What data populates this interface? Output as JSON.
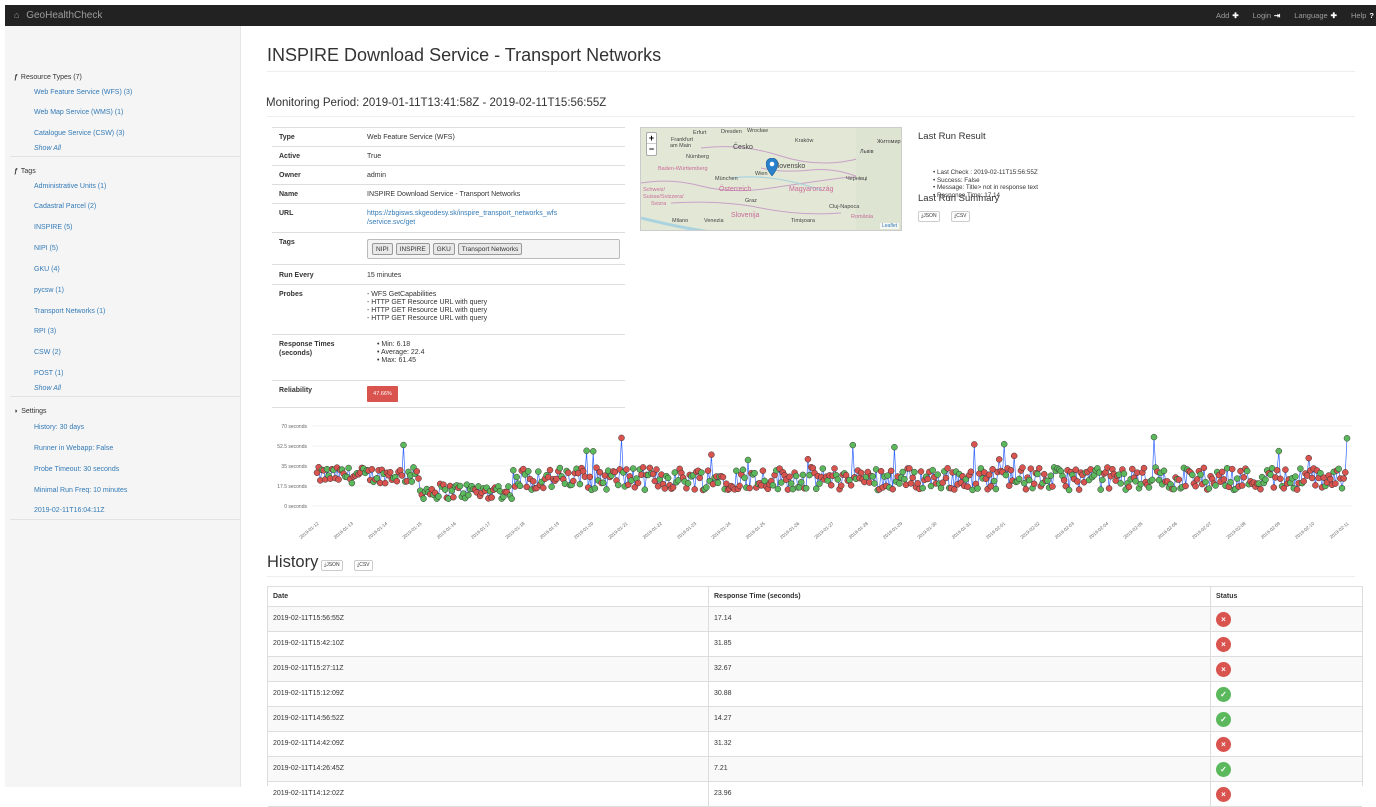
{
  "navbar": {
    "brand": "GeoHealthCheck",
    "items": [
      {
        "label": "Add",
        "icon": "✚"
      },
      {
        "label": "Login",
        "icon": "⇥"
      },
      {
        "label": "Language",
        "icon": "✚"
      },
      {
        "label": "Help",
        "icon": "?"
      }
    ]
  },
  "sidebar": {
    "resource_types_heading": "Resource Types (7)",
    "resource_types": [
      "Web Feature Service (WFS) (3)",
      "Web Map Service (WMS) (1)",
      "Catalogue Service (CSW) (3)"
    ],
    "resource_types_more": "Show All",
    "tags_heading": "Tags",
    "tags": [
      "Administrative Units (1)",
      "Cadastral Parcel (2)",
      "INSPIRE (5)",
      "NIPI (5)",
      "GKU (4)",
      "pycsw (1)",
      "Transport Networks (1)",
      "RPI (3)",
      "CSW (2)",
      "POST (1)"
    ],
    "tags_more": "Show All",
    "settings_heading": "Settings",
    "settings": [
      "History: 30 days",
      "Runner in Webapp: False",
      "Probe Timeout: 30 seconds",
      "Minimal Run Freq: 10 minutes",
      "2019-02-11T16:04:11Z"
    ]
  },
  "page": {
    "title": "INSPIRE Download Service - Transport Networks",
    "period": "Monitoring Period: 2019-01-11T13:41:58Z - 2019-02-11T15:56:55Z"
  },
  "details": {
    "type_label": "Type",
    "type": "Web Feature Service (WFS)",
    "active_label": "Active",
    "active": "True",
    "owner_label": "Owner",
    "owner": "admin",
    "name_label": "Name",
    "name": "INSPIRE Download Service - Transport Networks",
    "url_label": "URL",
    "url_line1": "https://zbgisws.skgeodesy.sk/inspire_transport_networks_wfs",
    "url_line2": "/service.svc/get",
    "tags_label": "Tags",
    "tags": [
      "NIPI",
      "INSPIRE",
      "GKU",
      "Transport Networks"
    ],
    "run_every_label": "Run Every",
    "run_every": "15 minutes",
    "probes_label": "Probes",
    "probes": [
      "- WFS GetCapabilities",
      "- HTTP GET Resource URL with query",
      "- HTTP GET Resource URL with query",
      "- HTTP GET Resource URL with query"
    ],
    "response_label_1": "Response Times",
    "response_label_2": "(seconds)",
    "response": [
      "Min: 6.18",
      "Average: 22.4",
      "Max: 61.45"
    ],
    "reliability_label": "Reliability",
    "reliability": "47.66%"
  },
  "map": {
    "zoom_in": "+",
    "zoom_out": "−",
    "attribution": "Leaflet",
    "labels": [
      "Erfurt",
      "Dresden",
      "Wrocław",
      "Frankfurt",
      "am Main",
      "Česko",
      "Kraków",
      "Nürnberg",
      "Baden-Württemberg",
      "München",
      "Wien",
      "Slovensko",
      "Schweiz/",
      "Suisse/Svizzera/",
      "Svizra",
      "Österreich",
      "Graz",
      "Magyarország",
      "Cluj-Napoca",
      "Milano",
      "Venezia",
      "Slovenija",
      "Timișoara",
      "România",
      "Львів",
      "Житомир",
      "Чернівці"
    ]
  },
  "last_run": {
    "title": "Last Run Result",
    "items": [
      "Last Check : 2019-02-11T15:56:55Z",
      "Success: False",
      "Message: Title> not in response text",
      "Response Time: 17.14"
    ],
    "summary_title": "Last Run Summary",
    "json_btn": "JSON",
    "csv_btn": "CSV"
  },
  "chart_data": {
    "type": "scatter",
    "y_tick_labels": [
      "70 seconds",
      "52.5 seconds",
      "35 seconds",
      "17.5 seconds",
      "0 seconds"
    ],
    "ylim": [
      0,
      70
    ],
    "x_tick_labels": [
      "2019-01-12",
      "2019-01-13",
      "2019-01-14",
      "2019-01-15",
      "2019-01-16",
      "2019-01-17",
      "2019-01-18",
      "2019-01-19",
      "2019-01-20",
      "2019-01-21",
      "2019-01-22",
      "2019-01-23",
      "2019-01-24",
      "2019-01-25",
      "2019-01-26",
      "2019-01-27",
      "2019-01-28",
      "2019-01-29",
      "2019-01-30",
      "2019-01-31",
      "2019-02-01",
      "2019-02-02",
      "2019-02-03",
      "2019-02-04",
      "2019-02-05",
      "2019-02-06",
      "2019-02-07",
      "2019-02-08",
      "2019-02-09",
      "2019-02-10",
      "2019-02-11"
    ],
    "colors": {
      "fail": "#d9534f",
      "ok": "#5cb85c",
      "line": "#3366ff"
    }
  },
  "history": {
    "title": "History",
    "json_btn": "JSON",
    "csv_btn": "CSV",
    "columns": [
      "Date",
      "Response Time (seconds)",
      "Status"
    ],
    "rows": [
      {
        "date": "2019-02-11T15:56:55Z",
        "time": "17.14",
        "ok": false
      },
      {
        "date": "2019-02-11T15:42:10Z",
        "time": "31.85",
        "ok": false
      },
      {
        "date": "2019-02-11T15:27:11Z",
        "time": "32.67",
        "ok": false
      },
      {
        "date": "2019-02-11T15:12:09Z",
        "time": "30.88",
        "ok": true
      },
      {
        "date": "2019-02-11T14:56:52Z",
        "time": "14.27",
        "ok": true
      },
      {
        "date": "2019-02-11T14:42:09Z",
        "time": "31.32",
        "ok": false
      },
      {
        "date": "2019-02-11T14:26:45Z",
        "time": "7.21",
        "ok": true
      },
      {
        "date": "2019-02-11T14:12:02Z",
        "time": "23.96",
        "ok": false
      }
    ]
  }
}
